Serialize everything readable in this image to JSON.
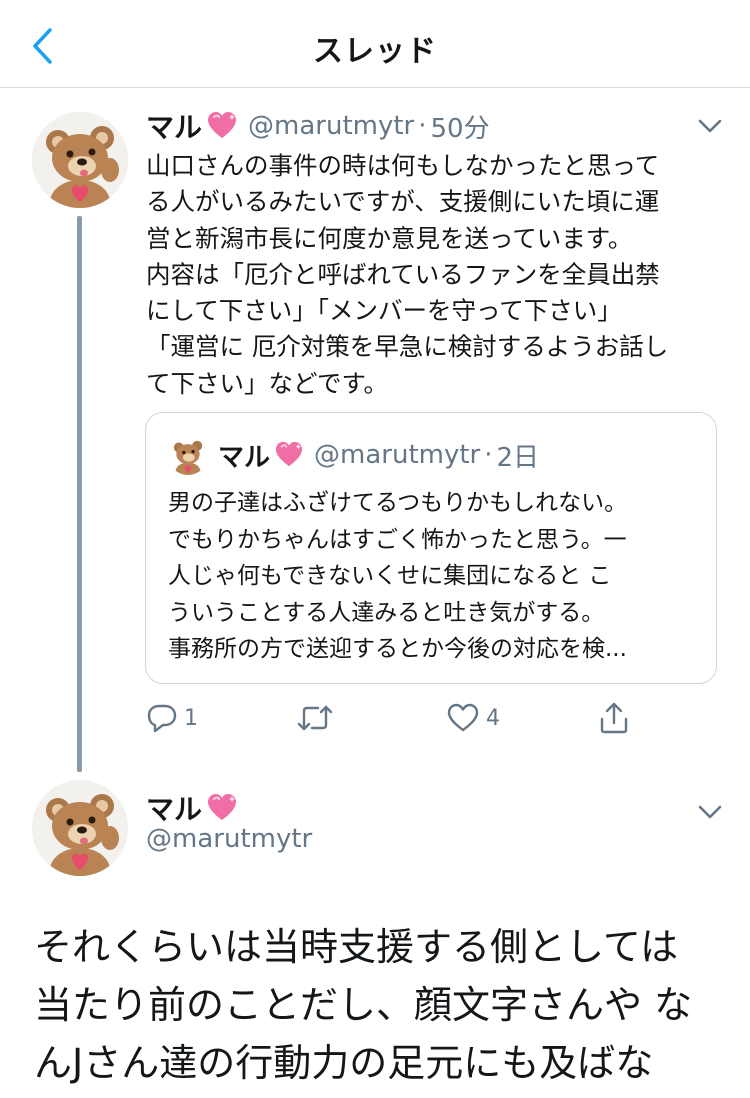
{
  "header": {
    "title": "スレッド"
  },
  "tweet1": {
    "name": "マル",
    "handle": "@marutmytr",
    "separator": "·",
    "time": "50分",
    "text": "山口さんの事件の時は何もしなかったと思って\nる人がいるみたいですが、支援側にいた頃に運\n営と新潟市長に何度か意見を送っています。\n内容は「厄介と呼ばれているファンを全員出禁\nにして下さい」「メンバーを守って下さい」\n「運営に 厄介対策を早急に検討するようお話し\nて下さい」などです。",
    "quote": {
      "name": "マル",
      "handle": "@marutmytr",
      "separator": "·",
      "time": "2日",
      "text": "男の子達はふざけてるつもりかもしれない。\nでもりかちゃんはすごく怖かったと思う。一\n人じゃ何もできないくせに集団になると こ\nういうことする人達みると吐き気がする。\n事務所の方で送迎するとか今後の対応を検..."
    },
    "actions": {
      "reply_count": "1",
      "retweet_count": "",
      "like_count": "4"
    }
  },
  "tweet2": {
    "name": "マル",
    "handle": "@marutmytr",
    "text": "それくらいは当時支援する側としては\n当たり前のことだし、顔文字さんや な\nんJさん達の行動力の足元にも及ばな"
  },
  "colors": {
    "text": "#14171a",
    "secondary": "#657786",
    "accent": "#1da1f2",
    "heart": "#e0245e",
    "thread_line": "#8a9aa8"
  },
  "icons": [
    "back-arrow-icon",
    "sparkling-heart-icon",
    "chevron-down-icon",
    "reply-icon",
    "retweet-icon",
    "like-icon",
    "share-icon"
  ]
}
